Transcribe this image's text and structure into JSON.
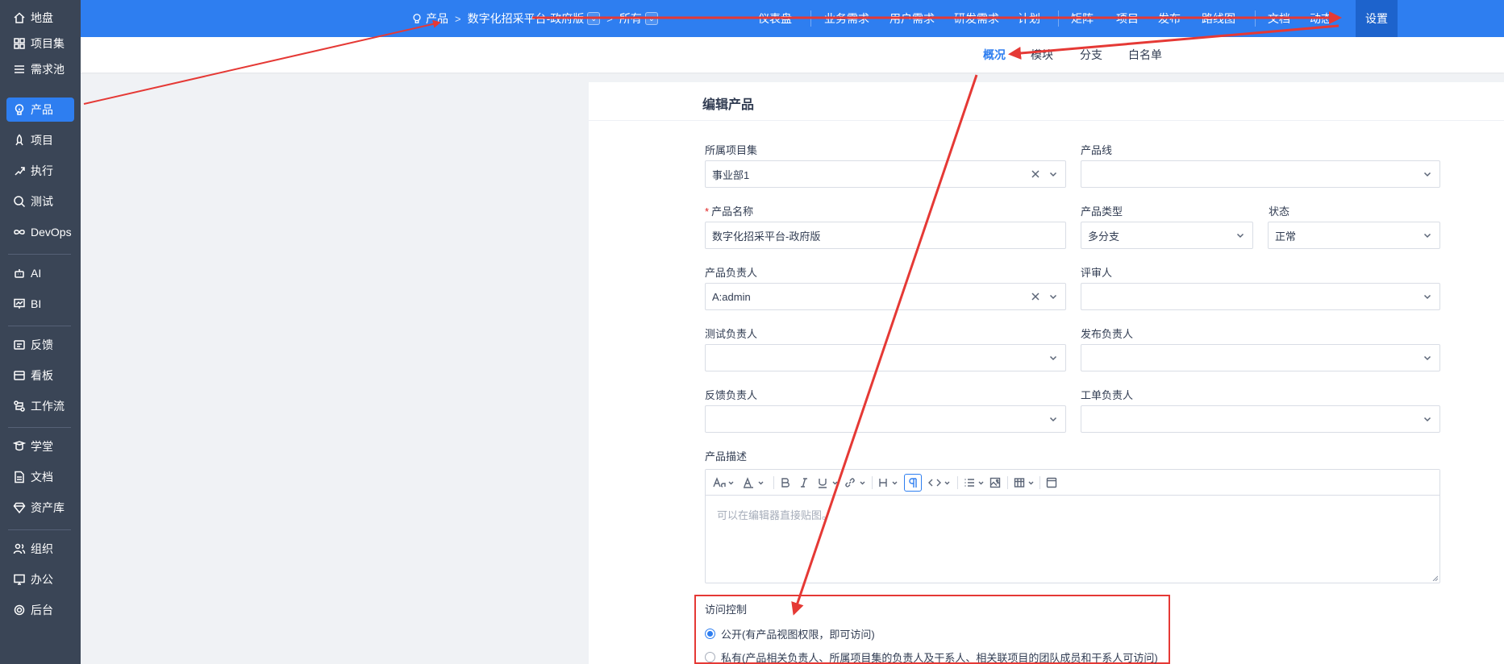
{
  "sidebar": {
    "items": [
      {
        "label": "地盘",
        "icon": "home-icon"
      },
      {
        "label": "项目集",
        "icon": "grid-icon"
      },
      {
        "label": "需求池",
        "icon": "list-icon"
      },
      {
        "label": "产品",
        "icon": "bulb-icon",
        "active": true
      },
      {
        "label": "项目",
        "icon": "rocket-icon"
      },
      {
        "label": "执行",
        "icon": "run-icon"
      },
      {
        "label": "测试",
        "icon": "bug-search-icon"
      },
      {
        "label": "DevOps",
        "icon": "infinity-icon"
      },
      {
        "label": "AI",
        "icon": "robot-icon"
      },
      {
        "label": "BI",
        "icon": "chart-board-icon"
      },
      {
        "label": "反馈",
        "icon": "feedback-icon"
      },
      {
        "label": "看板",
        "icon": "kanban-icon"
      },
      {
        "label": "工作流",
        "icon": "workflow-icon"
      },
      {
        "label": "学堂",
        "icon": "school-icon"
      },
      {
        "label": "文档",
        "icon": "document-icon"
      },
      {
        "label": "资产库",
        "icon": "diamond-icon"
      },
      {
        "label": "组织",
        "icon": "users-icon"
      },
      {
        "label": "办公",
        "icon": "office-icon"
      },
      {
        "label": "后台",
        "icon": "gear-icon"
      }
    ]
  },
  "topbar": {
    "breadcrumb_product": "产品",
    "breadcrumb_name": "数字化招采平台-政府版",
    "breadcrumb_scope": "所有",
    "nav": [
      "仪表盘",
      "业务需求",
      "用户需求",
      "研发需求",
      "计划",
      "矩阵",
      "项目",
      "发布",
      "路线图",
      "文档",
      "动态"
    ],
    "settings": "设置"
  },
  "subnav": {
    "tabs": [
      "概况",
      "模块",
      "分支",
      "白名单"
    ],
    "active": "概况"
  },
  "form": {
    "title": "编辑产品",
    "program_label": "所属项目集",
    "program_value": "事业部1",
    "line_label": "产品线",
    "line_value": "",
    "name_label": "产品名称",
    "name_value": "数字化招采平台-政府版",
    "type_label": "产品类型",
    "type_value": "多分支",
    "status_label": "状态",
    "status_value": "正常",
    "po_label": "产品负责人",
    "po_value": "A:admin",
    "reviewer_label": "评审人",
    "reviewer_value": "",
    "qd_label": "测试负责人",
    "qd_value": "",
    "rd_label": "发布负责人",
    "rd_value": "",
    "feedback_label": "反馈负责人",
    "feedback_value": "",
    "ticket_label": "工单负责人",
    "ticket_value": "",
    "desc_label": "产品描述",
    "desc_placeholder": "可以在编辑器直接贴图。",
    "acl_label": "访问控制",
    "acl_options": [
      {
        "label": "公开(有产品视图权限，即可访问)",
        "checked": true
      },
      {
        "label": "私有(产品相关负责人、所属项目集的负责人及干系人、相关联项目的团队成员和干系人可访问)",
        "checked": false
      }
    ]
  },
  "colors": {
    "brand": "#2e7ef0",
    "sidebar_bg": "#3a4556",
    "annotation": "#e53935"
  }
}
